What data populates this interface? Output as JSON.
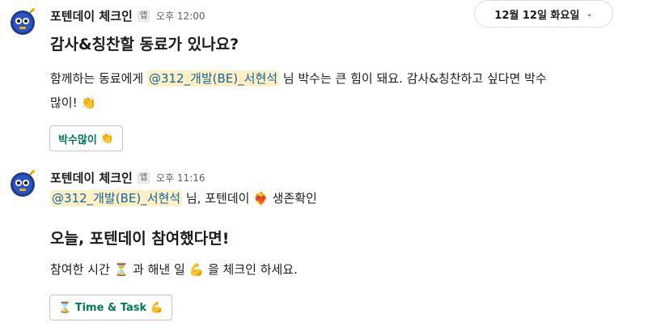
{
  "date_divider": {
    "label": "12월 12일 화요일",
    "chevron_icon": "chevron-down-icon"
  },
  "messages": [
    {
      "sender": "포텐데이 체크인",
      "badge": "앱",
      "time": "오후 12:00",
      "heading": "감사&칭찬할 동료가 있나요?",
      "line1_prefix": "함께하는 동료에게 ",
      "mention": "@312_개발(BE)_서현석",
      "line1_suffix": " 님 박수는 큰 힘이 돼요. 감사&칭찬하고 싶다면 박수",
      "line2": "많이!",
      "line2_emoji": "👏",
      "button_label": "박수많이",
      "button_emoji": "👏"
    },
    {
      "sender": "포텐데이 체크인",
      "badge": "앱",
      "time": "오후 11:16",
      "mention": "@312_개발(BE)_서현석",
      "line1_suffix": " 님, 포텐데이 ",
      "line1_emoji": "❤️‍🔥",
      "line1_tail": " 생존확인",
      "heading": "오늘, 포텐데이 참여했다면!",
      "line2_prefix": "참여한 시간 ",
      "line2_emoji1": "⏳",
      "line2_mid": " 과 해낸 일 ",
      "line2_emoji2": "💪",
      "line2_suffix": " 을 체크인 하세요.",
      "button_emoji1": "⌛",
      "button_label": "Time & Task",
      "button_emoji2": "💪"
    }
  ],
  "colors": {
    "mention_bg": "#fdf0c4",
    "mention_text": "#1264a3",
    "button_text": "#007a5a"
  }
}
